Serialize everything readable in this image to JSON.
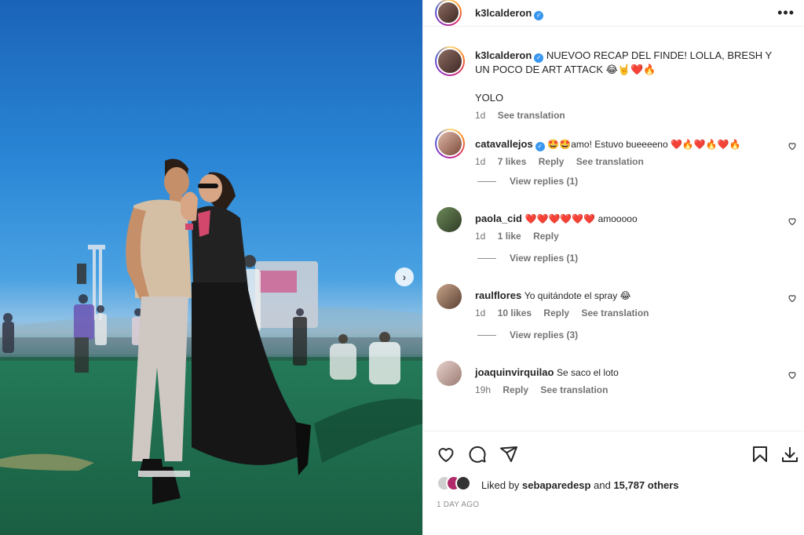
{
  "post": {
    "username": "k3lcalderon",
    "caption": "NUEVOO RECAP DEL FINDE! LOLLA, BRESH Y UN POCO DE ART ATTACK 😂🤘❤️🔥",
    "caption_line2": "YOLO",
    "caption_time": "1d",
    "see_translation": "See translation"
  },
  "comments": [
    {
      "username": "catavallejos",
      "verified": true,
      "text": "🤩🤩amo! Estuvo bueeeeno ❤️🔥❤️🔥❤️🔥",
      "time": "1d",
      "likes": "7 likes",
      "reply": "Reply",
      "translate": "See translation",
      "view_replies": "View replies (1)"
    },
    {
      "username": "paola_cid",
      "verified": false,
      "text": "❤️❤️❤️❤️❤️❤️ amooooo",
      "time": "1d",
      "likes": "1 like",
      "reply": "Reply",
      "translate": "",
      "view_replies": "View replies (1)"
    },
    {
      "username": "raulflores",
      "verified": false,
      "text": "Yo quitándote el spray 😂",
      "time": "1d",
      "likes": "10 likes",
      "reply": "Reply",
      "translate": "See translation",
      "view_replies": "View replies (3)"
    },
    {
      "username": "joaquinvirquilao",
      "verified": false,
      "text": "Se saco el loto",
      "time": "19h",
      "likes": "",
      "reply": "Reply",
      "translate": "See translation",
      "view_replies": ""
    }
  ],
  "actions": {
    "icons": [
      "heart-icon",
      "comment-icon",
      "share-icon",
      "bookmark-icon",
      "download-icon"
    ]
  },
  "likes": {
    "prefix": "Liked by",
    "user": "sebaparedesp",
    "conj": "and",
    "others": "15,787 others"
  },
  "time_ago": "1 DAY AGO",
  "colors": {
    "verified": "#3897f0",
    "heart_red": "#ed4956",
    "muted": "#737373"
  }
}
